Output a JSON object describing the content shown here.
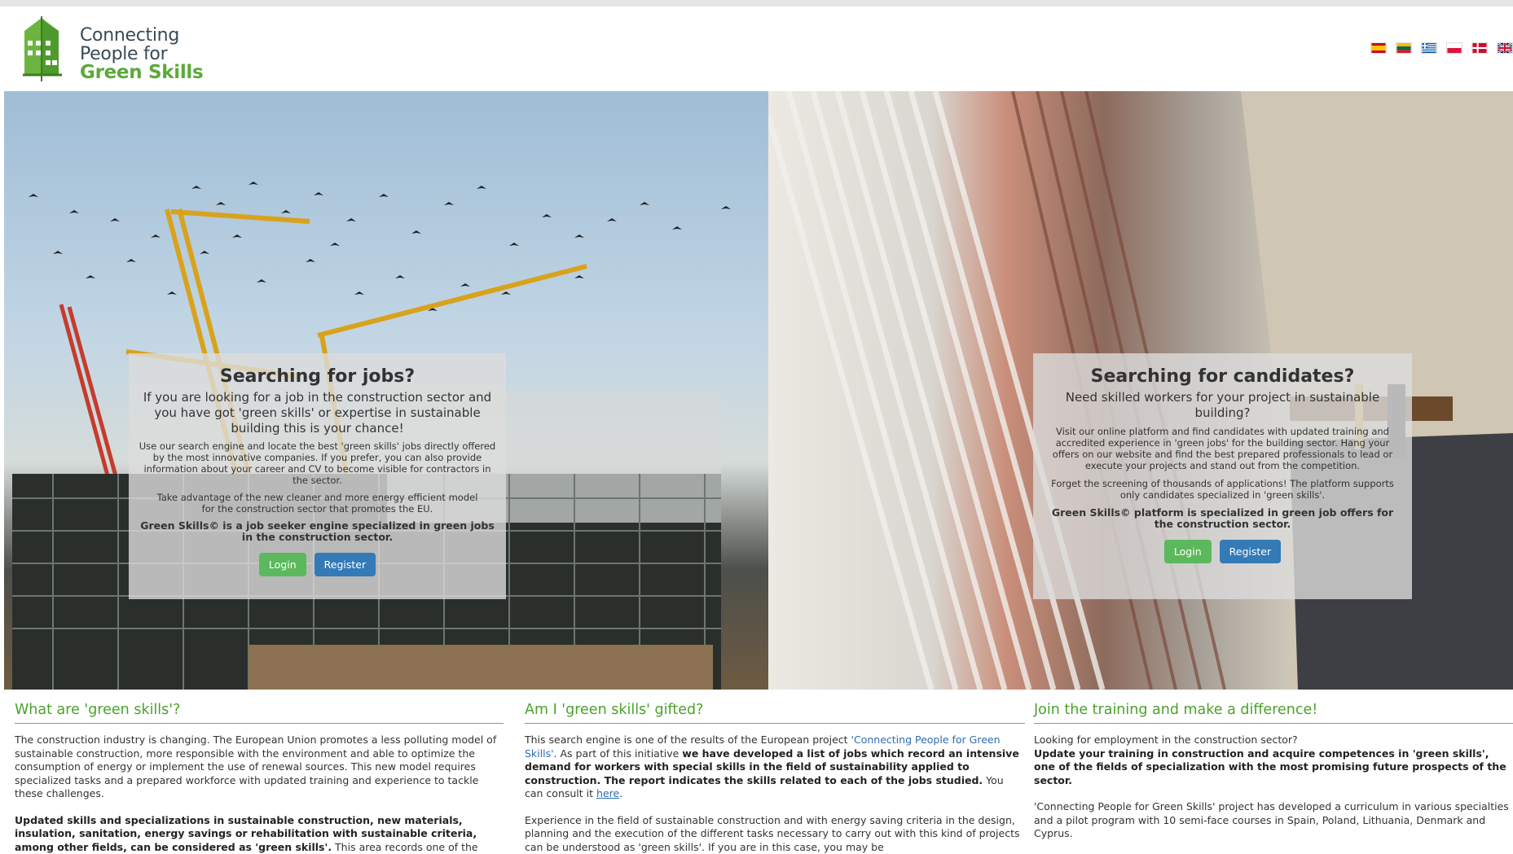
{
  "logo": {
    "line1": "Connecting",
    "line2": "People for",
    "line3": "Green Skills"
  },
  "flags": [
    {
      "name": "spanish-flag",
      "colors": [
        "#c60b1e",
        "#ffc400",
        "#c60b1e"
      ]
    },
    {
      "name": "lithuanian-flag",
      "colors": [
        "#fdb913",
        "#006a44",
        "#c1272d"
      ]
    },
    {
      "name": "greek-flag",
      "colors": [
        "#0d5eaf",
        "#ffffff",
        "#0d5eaf"
      ]
    },
    {
      "name": "polish-flag",
      "colors": [
        "#ffffff",
        "#dc143c"
      ]
    },
    {
      "name": "danish-flag",
      "colors": [
        "#c8102e",
        "#ffffff"
      ]
    },
    {
      "name": "uk-flag",
      "colors": [
        "#012169",
        "#ffffff",
        "#c8102e"
      ]
    }
  ],
  "jobs_panel": {
    "title": "Searching for jobs?",
    "lead": "If you are looking for a job in the construction sector and you have got 'green skills' or expertise in sustainable building this is your chance!",
    "p1": "Use our search engine and locate the best 'green skills' jobs directly offered by the most innovative companies. If you prefer, you can also provide information about your career and CV to become visible for contractors in the sector.",
    "p2": "Take advantage of the new cleaner and more energy efficient model for the construction sector that promotes the EU.",
    "p3": "Green Skills© is a job seeker engine specialized in green jobs in the construction sector.",
    "login": "Login",
    "register": "Register"
  },
  "candidates_panel": {
    "title": "Searching for candidates?",
    "lead": "Need skilled workers for your project in sustainable building?",
    "p1": "Visit our online platform and find candidates with updated training and accredited experience in 'green jobs' for the building sector. Hang your offers on our website and find the best prepared professionals to lead or execute your projects and stand out from the competition.",
    "p2": "Forget the screening of thousands of applications! The platform supports only candidates specialized in 'green skills'.",
    "p3": "Green Skills© platform is specialized in green job offers for the construction sector.",
    "login": "Login",
    "register": "Register"
  },
  "col1": {
    "title": "What are 'green skills'?",
    "p1": "The construction industry is changing. The European Union promotes a less polluting model of sustainable construction, more responsible with the environment and able to optimize the consumption of energy or implement the use of renewal sources. This new model requires specialized tasks and a prepared workforce with updated training and experience to tackle these challenges.",
    "p2_bold": "Updated skills and specializations in sustainable construction, new materials, insulation, sanitation, energy savings or rehabilitation with sustainable criteria, among other fields, can be considered as 'green skills'.",
    "p2_rest": " This area records one of the"
  },
  "col2": {
    "title": "Am I 'green skills' gifted?",
    "p1_a": "This search engine is one of the results of the European project ",
    "p1_link": "'Connecting People for Green Skills'",
    "p1_b": ". As part of this initiative ",
    "p1_bold": "we have developed a list of jobs which record an intensive demand for workers with special skills in the field of sustainability applied to construction. The report indicates the skills related to each of the jobs studied.",
    "p1_c": " You can consult it ",
    "p1_here": "here",
    "p1_d": ".",
    "p2": "Experience in the field of sustainable construction and with energy saving criteria in the design, planning and the execution of the different tasks necessary to carry out with this kind of projects can be understood as 'green skills'. If you are in this case, you may be"
  },
  "col3": {
    "title": "Join the training and make a difference!",
    "p1_a": "Looking for employment in the construction sector?",
    "p1_bold": "Update your training in construction and acquire competences in 'green skills', one of the fields of specialization with the most promising future prospects of the sector.",
    "p2": "'Connecting People for Green Skills' project has developed a curriculum in various specialties and a pilot program with 10 semi-face courses in Spain, Poland, Lithuania, Denmark and Cyprus."
  }
}
